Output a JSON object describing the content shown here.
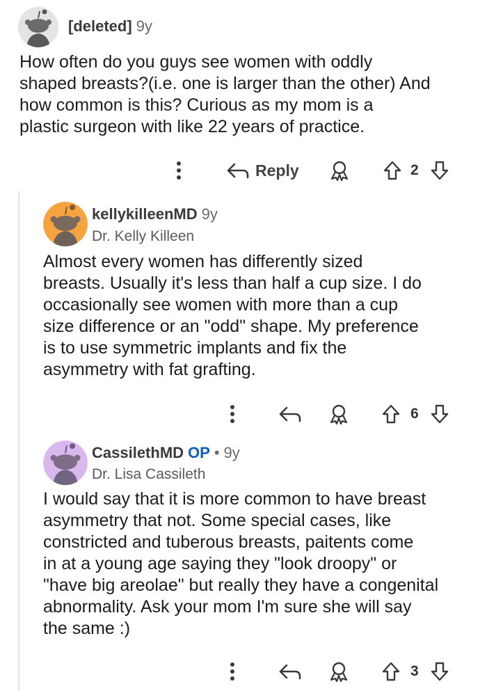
{
  "comments": [
    {
      "username": "[deleted]",
      "time": "9y",
      "flair": "",
      "op": "",
      "avatar_color": "#e4e4e4",
      "avatar_icon": "snoo-avatar-icon",
      "lines": [
        "How often do you guys see women with oddly",
        "shaped breasts?(i.e. one is larger than the other) And",
        "how common is this? Curious as my mom is a",
        "plastic surgeon with like 22 years of practice."
      ],
      "reply_label": "Reply",
      "votes": "2"
    },
    {
      "username": "kellykilleenMD",
      "time": "9y",
      "flair": "Dr. Kelly Killeen",
      "op": "",
      "avatar_color": "#f7a440",
      "avatar_icon": "snoo-avatar-icon",
      "lines": [
        "Almost every women has differently sized",
        "breasts. Usually it's less than half a cup size. I do",
        "occasionally see women with more than a cup",
        "size difference or an \"odd\" shape. My preference",
        "is to use symmetric implants and fix the",
        "asymmetry with fat grafting."
      ],
      "reply_label": "",
      "votes": "6"
    },
    {
      "username": "CassilethMD",
      "time": "9y",
      "flair": "Dr. Lisa Cassileth",
      "op": "OP",
      "dot": "•",
      "avatar_color": "#d9b8ef",
      "avatar_icon": "snoo-avatar-icon",
      "lines": [
        "I would say that it is more common to have breast",
        "asymmetry that not. Some special cases, like",
        "constricted and tuberous breasts, paitents come",
        "in at a young age saying they \"look droopy\" or",
        "\"have big areolae\" but really they have a congenital",
        "abnormality. Ask your mom I'm sure she will say",
        "the same :)"
      ],
      "reply_label": "",
      "votes": "3"
    }
  ],
  "icons": {
    "more": "more-options-icon",
    "reply": "reply-arrow-icon",
    "award": "award-icon",
    "upvote": "upvote-arrow-icon",
    "downvote": "downvote-arrow-icon"
  }
}
